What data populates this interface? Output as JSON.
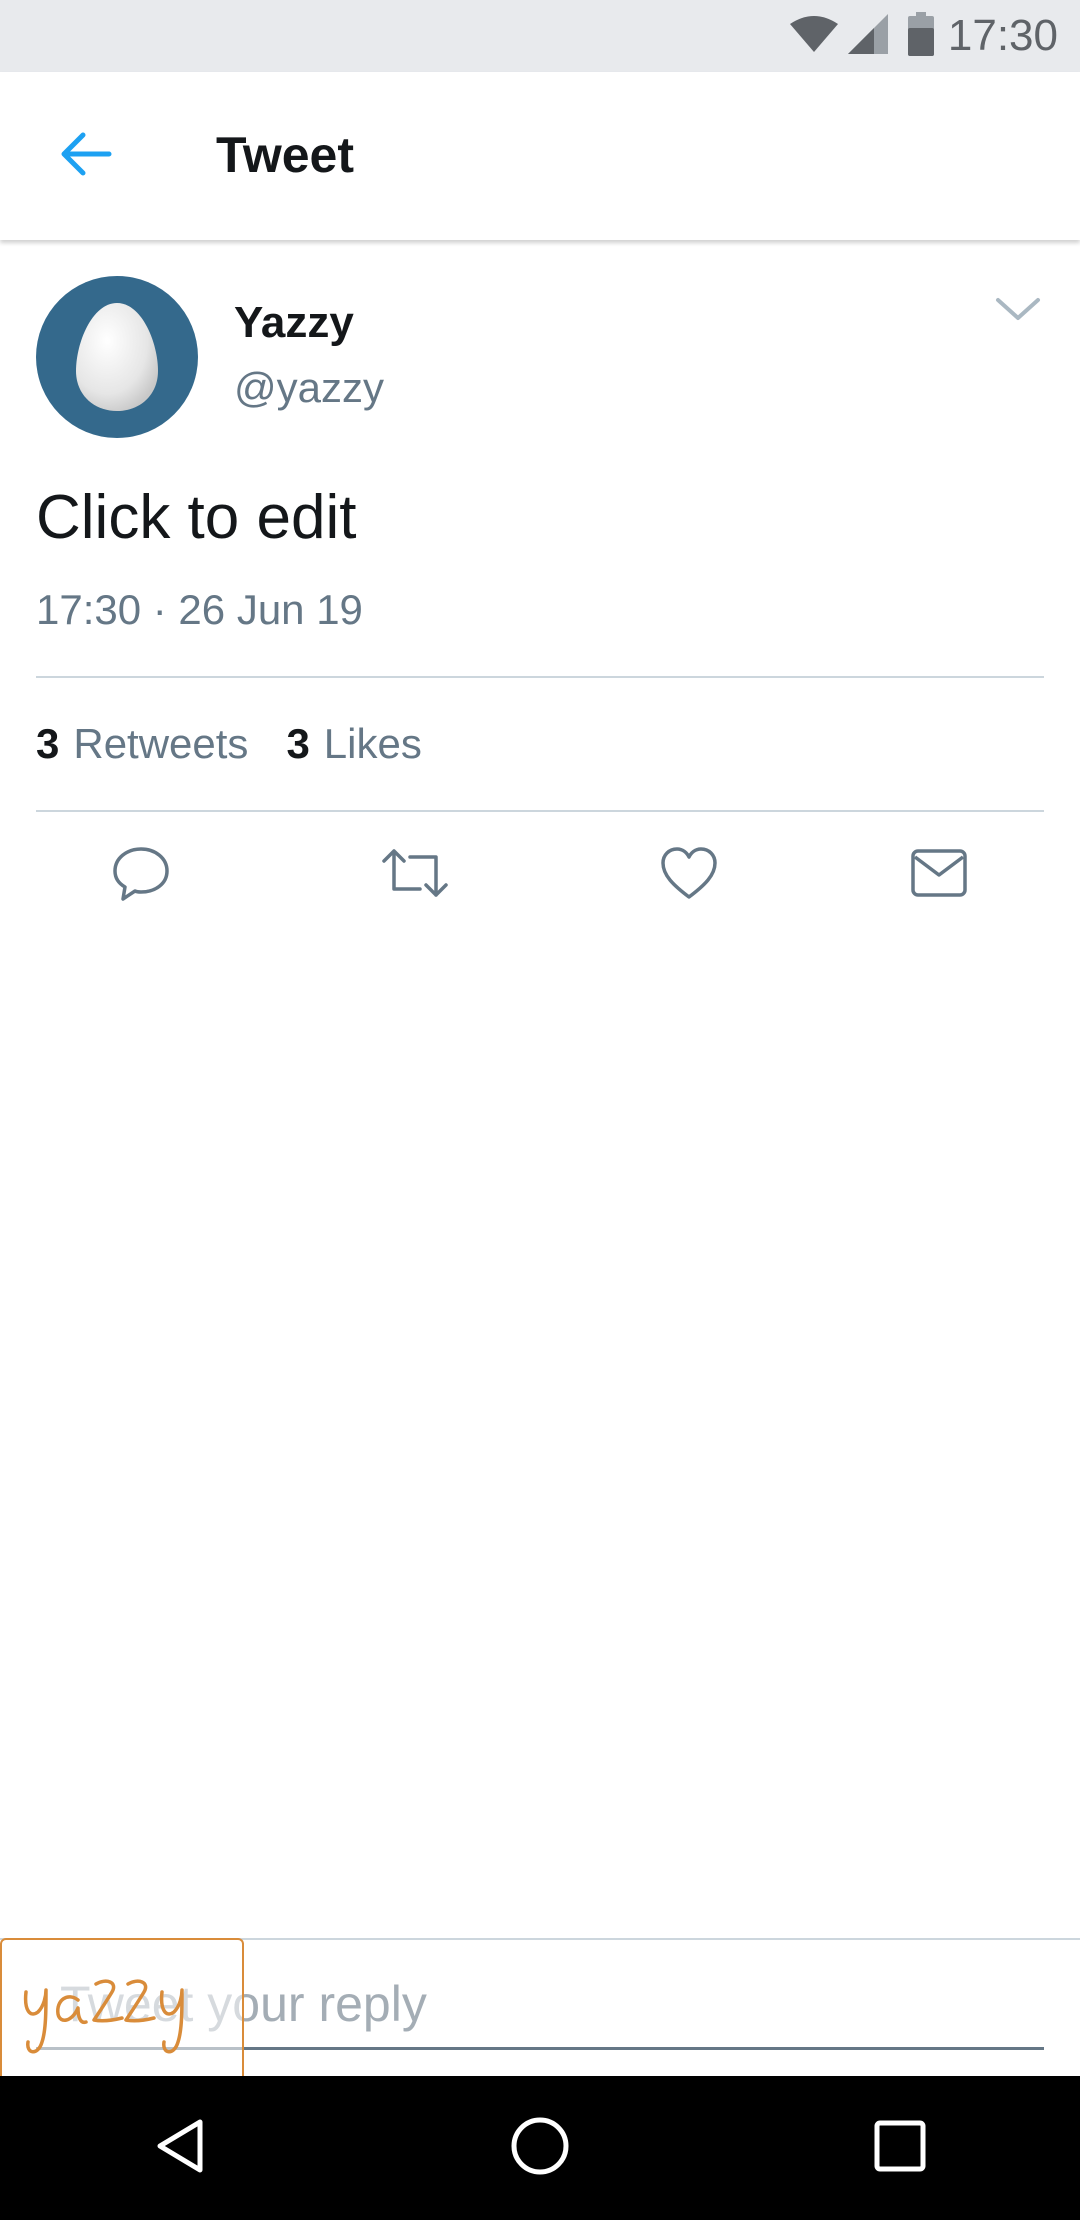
{
  "status_bar": {
    "time": "17:30",
    "icons": [
      "wifi-icon",
      "signal-icon",
      "battery-icon"
    ]
  },
  "app_bar": {
    "title": "Tweet",
    "back_icon": "arrow-left-icon"
  },
  "tweet": {
    "display_name": "Yazzy",
    "handle": "@yazzy",
    "text": "Click to edit",
    "timestamp": "17:30 · 26 Jun 19",
    "retweets_count": "3",
    "retweets_label": "Retweets",
    "likes_count": "3",
    "likes_label": "Likes",
    "actions": [
      "reply-icon",
      "retweet-icon",
      "like-icon",
      "direct-message-icon"
    ]
  },
  "reply": {
    "placeholder": "Tweet your reply"
  },
  "signature_text": "yazzy",
  "colors": {
    "accent": "#1da1f2",
    "avatar_bg": "#34698c",
    "secondary_text": "#657786",
    "divider": "#ccd6dd",
    "signature": "#d98c3a"
  }
}
